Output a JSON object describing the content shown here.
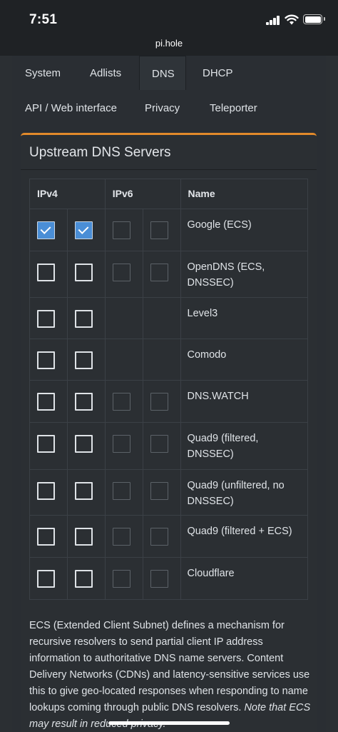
{
  "status_bar": {
    "time": "7:51"
  },
  "browser": {
    "url": "pi.hole"
  },
  "tabs": [
    {
      "label": "System"
    },
    {
      "label": "Adlists"
    },
    {
      "label": "DNS"
    },
    {
      "label": "DHCP"
    },
    {
      "label": "API / Web interface"
    },
    {
      "label": "Privacy"
    },
    {
      "label": "Teleporter"
    }
  ],
  "active_tab": "DNS",
  "panel": {
    "title": "Upstream DNS Servers",
    "headers": {
      "ipv4": "IPv4",
      "ipv6": "IPv6",
      "name": "Name"
    },
    "servers": [
      {
        "name": "Google (ECS)",
        "v4a": true,
        "v4b": true,
        "v6a": false,
        "v6b": false,
        "has_v6": true
      },
      {
        "name": "OpenDNS (ECS, DNSSEC)",
        "v4a": false,
        "v4b": false,
        "v6a": false,
        "v6b": false,
        "has_v6": true
      },
      {
        "name": "Level3",
        "v4a": false,
        "v4b": false,
        "has_v6": false
      },
      {
        "name": "Comodo",
        "v4a": false,
        "v4b": false,
        "has_v6": false
      },
      {
        "name": "DNS.WATCH",
        "v4a": false,
        "v4b": false,
        "v6a": false,
        "v6b": false,
        "has_v6": true
      },
      {
        "name": "Quad9 (filtered, DNSSEC)",
        "v4a": false,
        "v4b": false,
        "v6a": false,
        "v6b": false,
        "has_v6": true
      },
      {
        "name": "Quad9 (unfiltered, no DNSSEC)",
        "v4a": false,
        "v4b": false,
        "v6a": false,
        "v6b": false,
        "has_v6": true
      },
      {
        "name": "Quad9 (filtered + ECS)",
        "v4a": false,
        "v4b": false,
        "v6a": false,
        "v6b": false,
        "has_v6": true
      },
      {
        "name": "Cloudflare",
        "v4a": false,
        "v4b": false,
        "v6a": false,
        "v6b": false,
        "has_v6": true
      }
    ],
    "description": "ECS (Extended Client Subnet) defines a mechanism for recursive resolvers to send partial client IP address information to authoritative DNS name servers. Content Delivery Networks (CDNs) and latency-sensitive services use this to give geo-located responses when responding to name lookups coming through public DNS resolvers.",
    "description_note": "Note that ECS may result in reduced privacy."
  },
  "colors": {
    "accent": "#e28a2a",
    "checkbox_checked": "#4a8ed6",
    "background": "#2b2f33"
  }
}
